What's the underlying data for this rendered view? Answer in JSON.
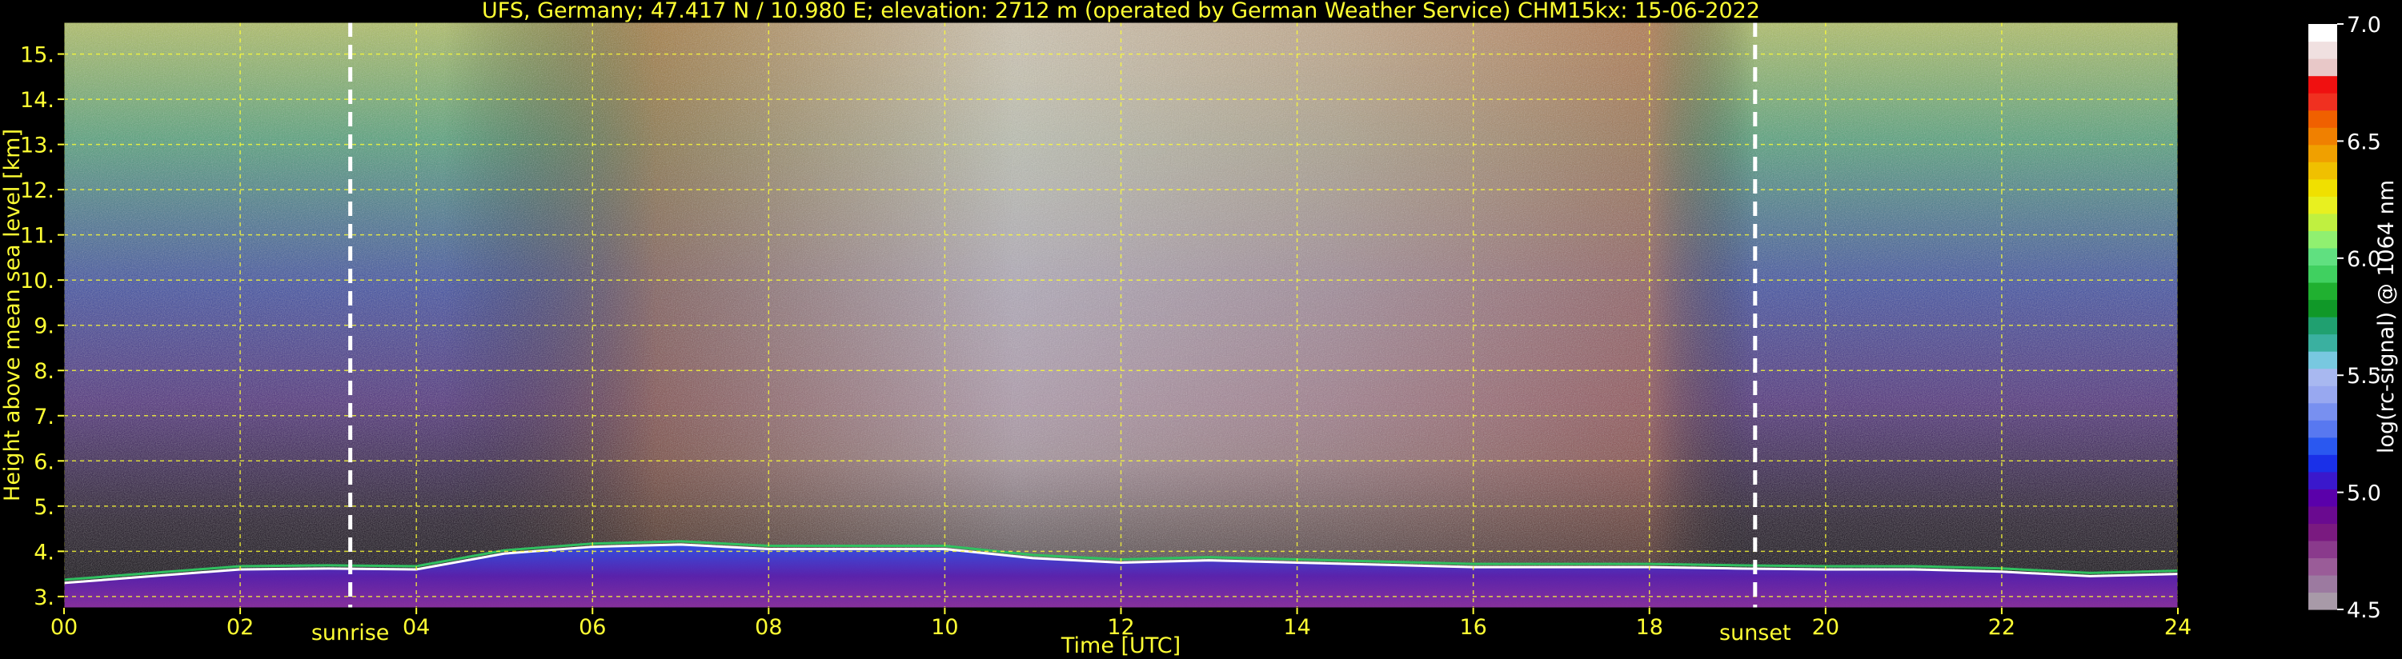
{
  "chart_data": {
    "type": "heatmap",
    "title": "UFS, Germany; 47.417 N / 10.980 E; elevation: 2712 m  (operated by German Weather Service)    CHM15kx: 15-06-2022",
    "xlabel": "Time [UTC]",
    "ylabel": "Height above mean sea level [km]",
    "xlim": [
      0,
      24
    ],
    "ylim": [
      2.75,
      15.7
    ],
    "x_ticks": [
      "00",
      "02",
      "04",
      "06",
      "08",
      "10",
      "12",
      "14",
      "16",
      "18",
      "20",
      "22",
      "24"
    ],
    "x_tick_values": [
      0,
      2,
      4,
      6,
      8,
      10,
      12,
      14,
      16,
      18,
      20,
      22,
      24
    ],
    "y_ticks": [
      "3.",
      "4.",
      "5.",
      "6.",
      "7.",
      "8.",
      "9.",
      "10.",
      "11.",
      "12.",
      "13.",
      "14.",
      "15."
    ],
    "y_tick_values": [
      3,
      4,
      5,
      6,
      7,
      8,
      9,
      10,
      11,
      12,
      13,
      14,
      15
    ],
    "grid": true,
    "annotations": [
      {
        "text": "sunrise",
        "x": 3.25
      },
      {
        "text": "sunset",
        "x": 19.2
      }
    ],
    "colorbar": {
      "label": "log(rc-signal) @ 1064 nm",
      "range": [
        4.5,
        7.0
      ],
      "ticks": [
        "4.5",
        "5.0",
        "5.5",
        "6.0",
        "6.5",
        "7.0"
      ],
      "tick_values": [
        4.5,
        5.0,
        5.5,
        6.0,
        6.5,
        7.0
      ],
      "colors": [
        "#a89aa8",
        "#9c7aa0",
        "#9a5c98",
        "#8a3a8c",
        "#7a1a80",
        "#6a0a90",
        "#5a00aa",
        "#3a18cc",
        "#1a30e8",
        "#2a58f0",
        "#5878f0",
        "#7890f0",
        "#98a8f0",
        "#a8b8f0",
        "#78c8e0",
        "#3ab0a0",
        "#20a070",
        "#109828",
        "#20b030",
        "#40d060",
        "#60e080",
        "#90f070",
        "#c0f040",
        "#e8f020",
        "#f0e000",
        "#f0c000",
        "#f0a000",
        "#f08000",
        "#f06000",
        "#f03020",
        "#f01010",
        "#e8c8c8",
        "#f0e0e0",
        "#ffffff"
      ]
    },
    "boundary_layer_top": [
      [
        0,
        3.3
      ],
      [
        1,
        3.45
      ],
      [
        2,
        3.6
      ],
      [
        3,
        3.62
      ],
      [
        4,
        3.6
      ],
      [
        5,
        3.95
      ],
      [
        6,
        4.1
      ],
      [
        7,
        4.15
      ],
      [
        8,
        4.05
      ],
      [
        9,
        4.05
      ],
      [
        10,
        4.05
      ],
      [
        11,
        3.85
      ],
      [
        12,
        3.75
      ],
      [
        13,
        3.8
      ],
      [
        14,
        3.75
      ],
      [
        15,
        3.7
      ],
      [
        16,
        3.65
      ],
      [
        17,
        3.65
      ],
      [
        18,
        3.65
      ],
      [
        19,
        3.62
      ],
      [
        20,
        3.6
      ],
      [
        21,
        3.6
      ],
      [
        22,
        3.55
      ],
      [
        23,
        3.45
      ],
      [
        24,
        3.5
      ]
    ]
  }
}
